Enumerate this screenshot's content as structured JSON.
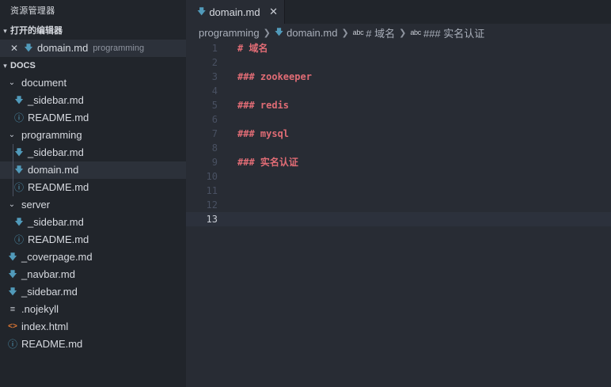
{
  "sidebar": {
    "title": "资源管理器",
    "open_editors": {
      "header": "打开的编辑器",
      "items": [
        {
          "name": "domain.md",
          "desc": "programming",
          "icon": "markdown-icon"
        }
      ]
    },
    "workspace": {
      "header": "DOCS",
      "tree": [
        {
          "label": "document",
          "type": "folder"
        },
        {
          "label": "_sidebar.md",
          "type": "md"
        },
        {
          "label": "README.md",
          "type": "info"
        },
        {
          "label": "programming",
          "type": "folder"
        },
        {
          "label": "_sidebar.md",
          "type": "md"
        },
        {
          "label": "domain.md",
          "type": "md"
        },
        {
          "label": "README.md",
          "type": "info"
        },
        {
          "label": "server",
          "type": "folder"
        },
        {
          "label": "_sidebar.md",
          "type": "md"
        },
        {
          "label": "README.md",
          "type": "info"
        },
        {
          "label": "_coverpage.md",
          "type": "md"
        },
        {
          "label": "_navbar.md",
          "type": "md"
        },
        {
          "label": "_sidebar.md",
          "type": "md"
        },
        {
          "label": ".nojekyll",
          "type": "text"
        },
        {
          "label": "index.html",
          "type": "html"
        },
        {
          "label": "README.md",
          "type": "info"
        }
      ]
    }
  },
  "editor": {
    "tab": {
      "label": "domain.md"
    },
    "breadcrumb": [
      "programming",
      "domain.md",
      "# 域名",
      "### 实名认证"
    ],
    "breadcrumb_abc": "abc",
    "lines": [
      {
        "n": "1",
        "text": "# 域名"
      },
      {
        "n": "2",
        "text": ""
      },
      {
        "n": "3",
        "text": "### zookeeper"
      },
      {
        "n": "4",
        "text": ""
      },
      {
        "n": "5",
        "text": "### redis"
      },
      {
        "n": "6",
        "text": ""
      },
      {
        "n": "7",
        "text": "### mysql"
      },
      {
        "n": "8",
        "text": ""
      },
      {
        "n": "9",
        "text": "### 实名认证"
      },
      {
        "n": "10",
        "text": ""
      },
      {
        "n": "11",
        "text": ""
      },
      {
        "n": "12",
        "text": ""
      },
      {
        "n": "13",
        "text": ""
      }
    ],
    "current_line": "13"
  },
  "colors": {
    "sidebar_bg": "#21252b",
    "editor_bg": "#282c34",
    "heading": "#e06c75",
    "markdown_icon": "#519aba",
    "html_icon": "#e37933"
  }
}
